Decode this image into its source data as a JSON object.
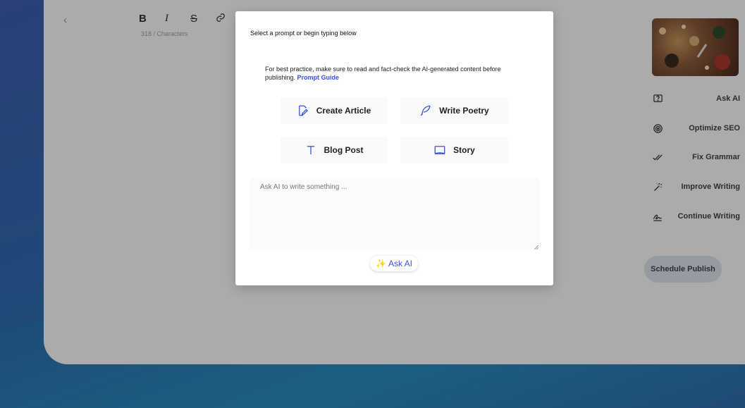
{
  "editor": {
    "toolbar": {
      "bold": "B",
      "italic": "I",
      "strike": "S"
    },
    "char_count": "318 / Characters"
  },
  "sidebar": {
    "items": [
      {
        "label": "Ask AI",
        "icon": "question-box-icon"
      },
      {
        "label": "Optimize SEO",
        "icon": "target-icon"
      },
      {
        "label": "Fix Grammar",
        "icon": "double-check-icon"
      },
      {
        "label": "Improve Writing",
        "icon": "magic-wand-icon"
      },
      {
        "label": "Continue Writing",
        "icon": "signature-icon"
      }
    ],
    "schedule_label": "Schedule Publish"
  },
  "modal": {
    "title": "Select a prompt or begin typing below",
    "notice": "For best practice, make sure to read and fact-check the AI-generated content before publishing.",
    "notice_link": "Prompt Guide",
    "prompts": [
      {
        "label": "Create Article",
        "icon": "edit-document-icon"
      },
      {
        "label": "Write Poetry",
        "icon": "quill-icon"
      },
      {
        "label": "Blog Post",
        "icon": "text-icon"
      },
      {
        "label": "Story",
        "icon": "book-icon"
      }
    ],
    "input_placeholder": "Ask AI to write something ...",
    "ask_label": "Ask AI",
    "ask_icon": "sparkles-icon",
    "accent_color": "#3b4fe0"
  }
}
